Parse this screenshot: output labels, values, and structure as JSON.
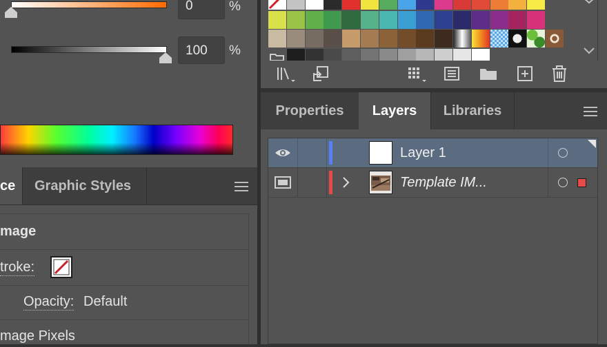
{
  "color_panel": {
    "tint_value": "0",
    "opacity_value": "100",
    "percent_sign": "%"
  },
  "appearance_panel": {
    "tabs": [
      "ce",
      "Graphic Styles"
    ],
    "rows": {
      "object_type": "mage",
      "stroke_label": "troke:",
      "opacity_label": "Opacity:",
      "opacity_value": "Default",
      "effect_label": "mage Pixels"
    }
  },
  "swatches": {
    "rows": [
      [
        "none",
        "#c4c4c4",
        "#ffffff",
        "#2b2b2b",
        "#e2302d",
        "#f1e43f",
        "#56ab5d",
        "#4aa4e8",
        "#2f3a8f",
        "#dc3a8c",
        "#d93937",
        "#e24a38",
        "#ec7c36",
        "#f2b13c",
        "#f8ea47"
      ],
      [
        "#d8e04a",
        "#9ac447",
        "#60b14a",
        "#3f9a4e",
        "#2f6b3e",
        "#56b28a",
        "#4ab7b1",
        "#3aa0d3",
        "#3069b1",
        "#2d3f8f",
        "#2a2a6a",
        "#5e2c89",
        "#8b2e8b",
        "#a5245d",
        "#d7337a"
      ],
      [
        "#c8bba1",
        "#9a8c7d",
        "#776c62",
        "#5a4f48",
        "#c69c6d",
        "#a57c52",
        "#8c6239",
        "#734d29",
        "#5a3b1d",
        "#3d2b1f",
        "grad-gray",
        "grad-warm",
        "pattern-check",
        "pattern-dots",
        "pattern-leaf",
        "pattern-swirl"
      ],
      [
        "folder",
        "#1e1e1e",
        "#333333",
        "#4a4a4a",
        "#5f5f5f",
        "#747474",
        "#8a8a8a",
        "#a0a0a0",
        "#b7b7b7",
        "#cecece",
        "#e6e6e6",
        "#ffffff"
      ]
    ]
  },
  "tabs": {
    "properties": "Properties",
    "layers": "Layers",
    "libraries": "Libraries"
  },
  "layers": [
    {
      "name": "Layer 1",
      "color": "#5a7ff5",
      "visible": true,
      "selected": true,
      "italic": false
    },
    {
      "name": "Template IM...",
      "color": "#e84a4a",
      "visible": true,
      "selected": false,
      "italic": true,
      "template": true
    }
  ],
  "colors": {
    "panel_bg": "#535353",
    "tab_bg": "#3e3e3e",
    "selected_row": "#5b6b80",
    "accent_orange": "#ff6a00"
  }
}
